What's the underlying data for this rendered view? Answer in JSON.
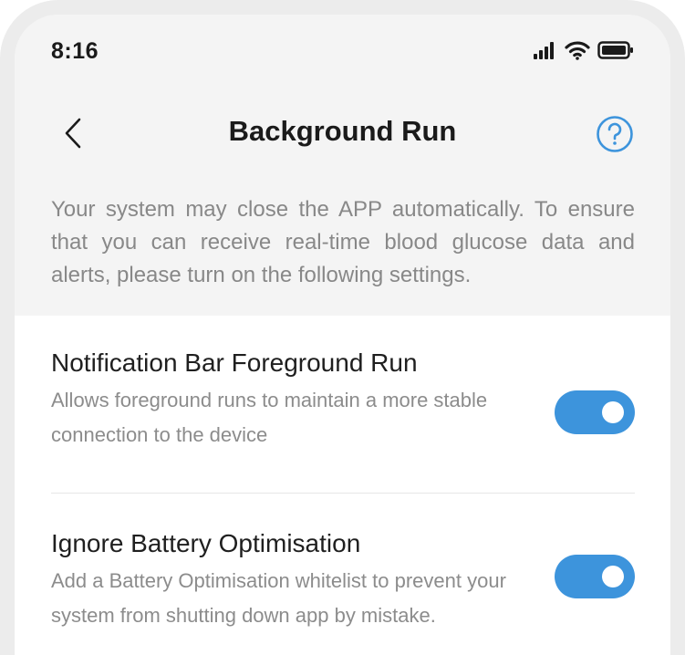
{
  "status_bar": {
    "time": "8:16",
    "icons": [
      "signal-icon",
      "wifi-icon",
      "battery-icon"
    ]
  },
  "nav": {
    "title": "Background Run",
    "back_icon": "chevron-left-icon",
    "help_icon": "question-circle-icon",
    "accent_color": "#3d94dc"
  },
  "description": "Your system may close the APP automatically. To ensure that you can receive real-time blood glucose data and alerts, please turn on the following settings.",
  "settings": [
    {
      "title": "Notification Bar Foreground Run",
      "description": "Allows foreground runs to maintain a more stable connection to the device",
      "enabled": true
    },
    {
      "title": "Ignore Battery Optimisation",
      "description": "Add a Battery Optimisation whitelist to prevent your system from shutting down app by mistake.",
      "enabled": true
    }
  ],
  "colors": {
    "toggle_on": "#3d94dc",
    "background": "#f4f4f4",
    "panel": "#ffffff"
  }
}
